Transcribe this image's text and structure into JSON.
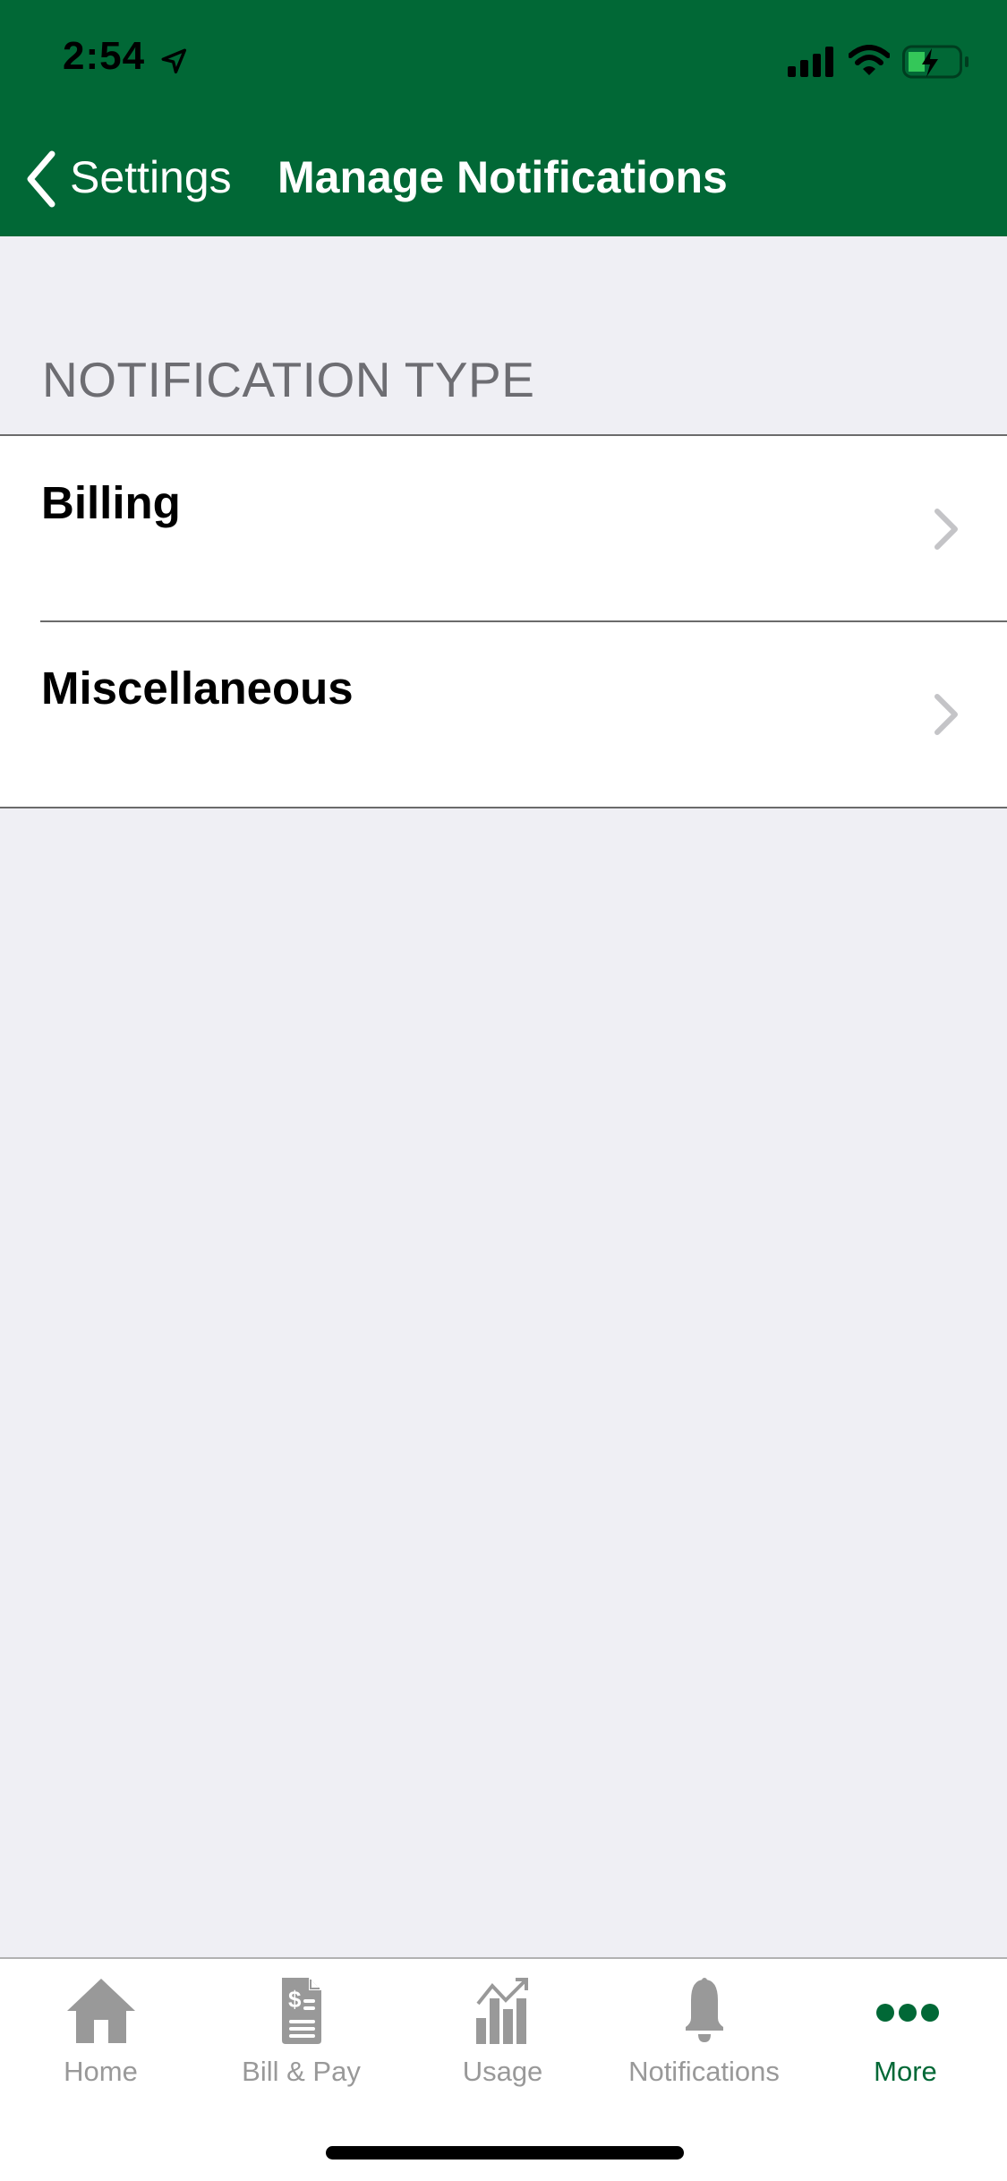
{
  "status_bar": {
    "time": "2:54",
    "icons": [
      "location-arrow-icon",
      "cellular-signal-icon",
      "wifi-icon",
      "battery-charging-icon"
    ]
  },
  "nav": {
    "back_label": "Settings",
    "title": "Manage Notifications"
  },
  "section": {
    "header": "NOTIFICATION TYPE",
    "rows": [
      {
        "title": "Billing",
        "icon": "chevron-right-icon"
      },
      {
        "title": "Miscellaneous",
        "icon": "chevron-right-icon"
      }
    ]
  },
  "tabbar": {
    "active_index": 4,
    "tabs": [
      {
        "label": "Home",
        "icon": "home-icon"
      },
      {
        "label": "Bill & Pay",
        "icon": "bill-icon"
      },
      {
        "label": "Usage",
        "icon": "usage-chart-icon"
      },
      {
        "label": "Notifications",
        "icon": "bell-icon"
      },
      {
        "label": "More",
        "icon": "more-dots-icon"
      }
    ]
  },
  "colors": {
    "brand_green": "#016836",
    "inactive_tab": "#999999",
    "section_header": "#6d6d72",
    "background": "#efeff4",
    "battery_fill": "#34c759"
  }
}
